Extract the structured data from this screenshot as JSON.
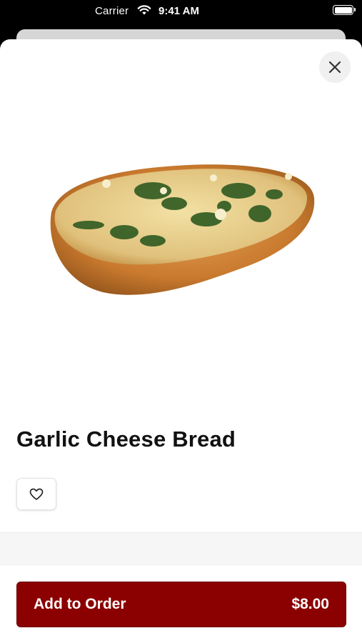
{
  "status_bar": {
    "carrier": "Carrier",
    "time": "9:41 AM",
    "wifi_icon": "wifi-icon",
    "battery_icon": "battery-icon"
  },
  "item": {
    "title": "Garlic Cheese Bread",
    "image_icon": "garlic-bread-image"
  },
  "actions": {
    "close_icon": "close-icon",
    "favorite_icon": "heart-outline-icon",
    "add_label": "Add to Order",
    "price": "$8.00"
  },
  "colors": {
    "accent": "#8b0000",
    "sheet_background": "#ffffff",
    "close_background": "#f0f0f0"
  }
}
